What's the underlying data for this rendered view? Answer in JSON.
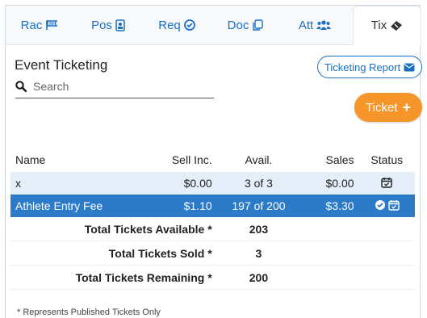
{
  "tabs": [
    {
      "label": "Rac",
      "icon": "flag-icon"
    },
    {
      "label": "Pos",
      "icon": "id-badge-icon"
    },
    {
      "label": "Req",
      "icon": "check-circle-icon"
    },
    {
      "label": "Doc",
      "icon": "copy-icon"
    },
    {
      "label": "Att",
      "icon": "users-icon"
    },
    {
      "label": "Tix",
      "icon": "ticket-icon"
    }
  ],
  "active_tab": "Tix",
  "page_title": "Event Ticketing",
  "report_button": {
    "label": "Ticketing Report",
    "icon": "envelope-icon"
  },
  "search": {
    "placeholder": "Search",
    "value": ""
  },
  "ticket_button": {
    "label": "Ticket",
    "icon": "plus-icon"
  },
  "table": {
    "headers": {
      "name": "Name",
      "sell": "Sell Inc.",
      "avail": "Avail.",
      "sales": "Sales",
      "status": "Status"
    },
    "rows": [
      {
        "name": "x",
        "sell": "$0.00",
        "avail": "3 of 3",
        "sales": "$0.00",
        "status_icons": [
          "calendar-check-icon"
        ]
      },
      {
        "name": "Athlete Entry Fee",
        "sell": "$1.10",
        "avail": "197 of 200",
        "sales": "$3.30",
        "status_icons": [
          "check-circle-icon",
          "calendar-check-icon"
        ]
      }
    ],
    "totals": [
      {
        "label": "Total Tickets Available *",
        "value": "203"
      },
      {
        "label": "Total Tickets Sold *",
        "value": "3"
      },
      {
        "label": "Total Tickets Remaining *",
        "value": "200"
      }
    ]
  },
  "footnote": "* Represents Published Tickets Only",
  "colors": {
    "accent": "#1a6fc4",
    "selected_row": "#2b7bc9",
    "light_row": "#e3eef8",
    "ticket_button": "#f6962a"
  }
}
